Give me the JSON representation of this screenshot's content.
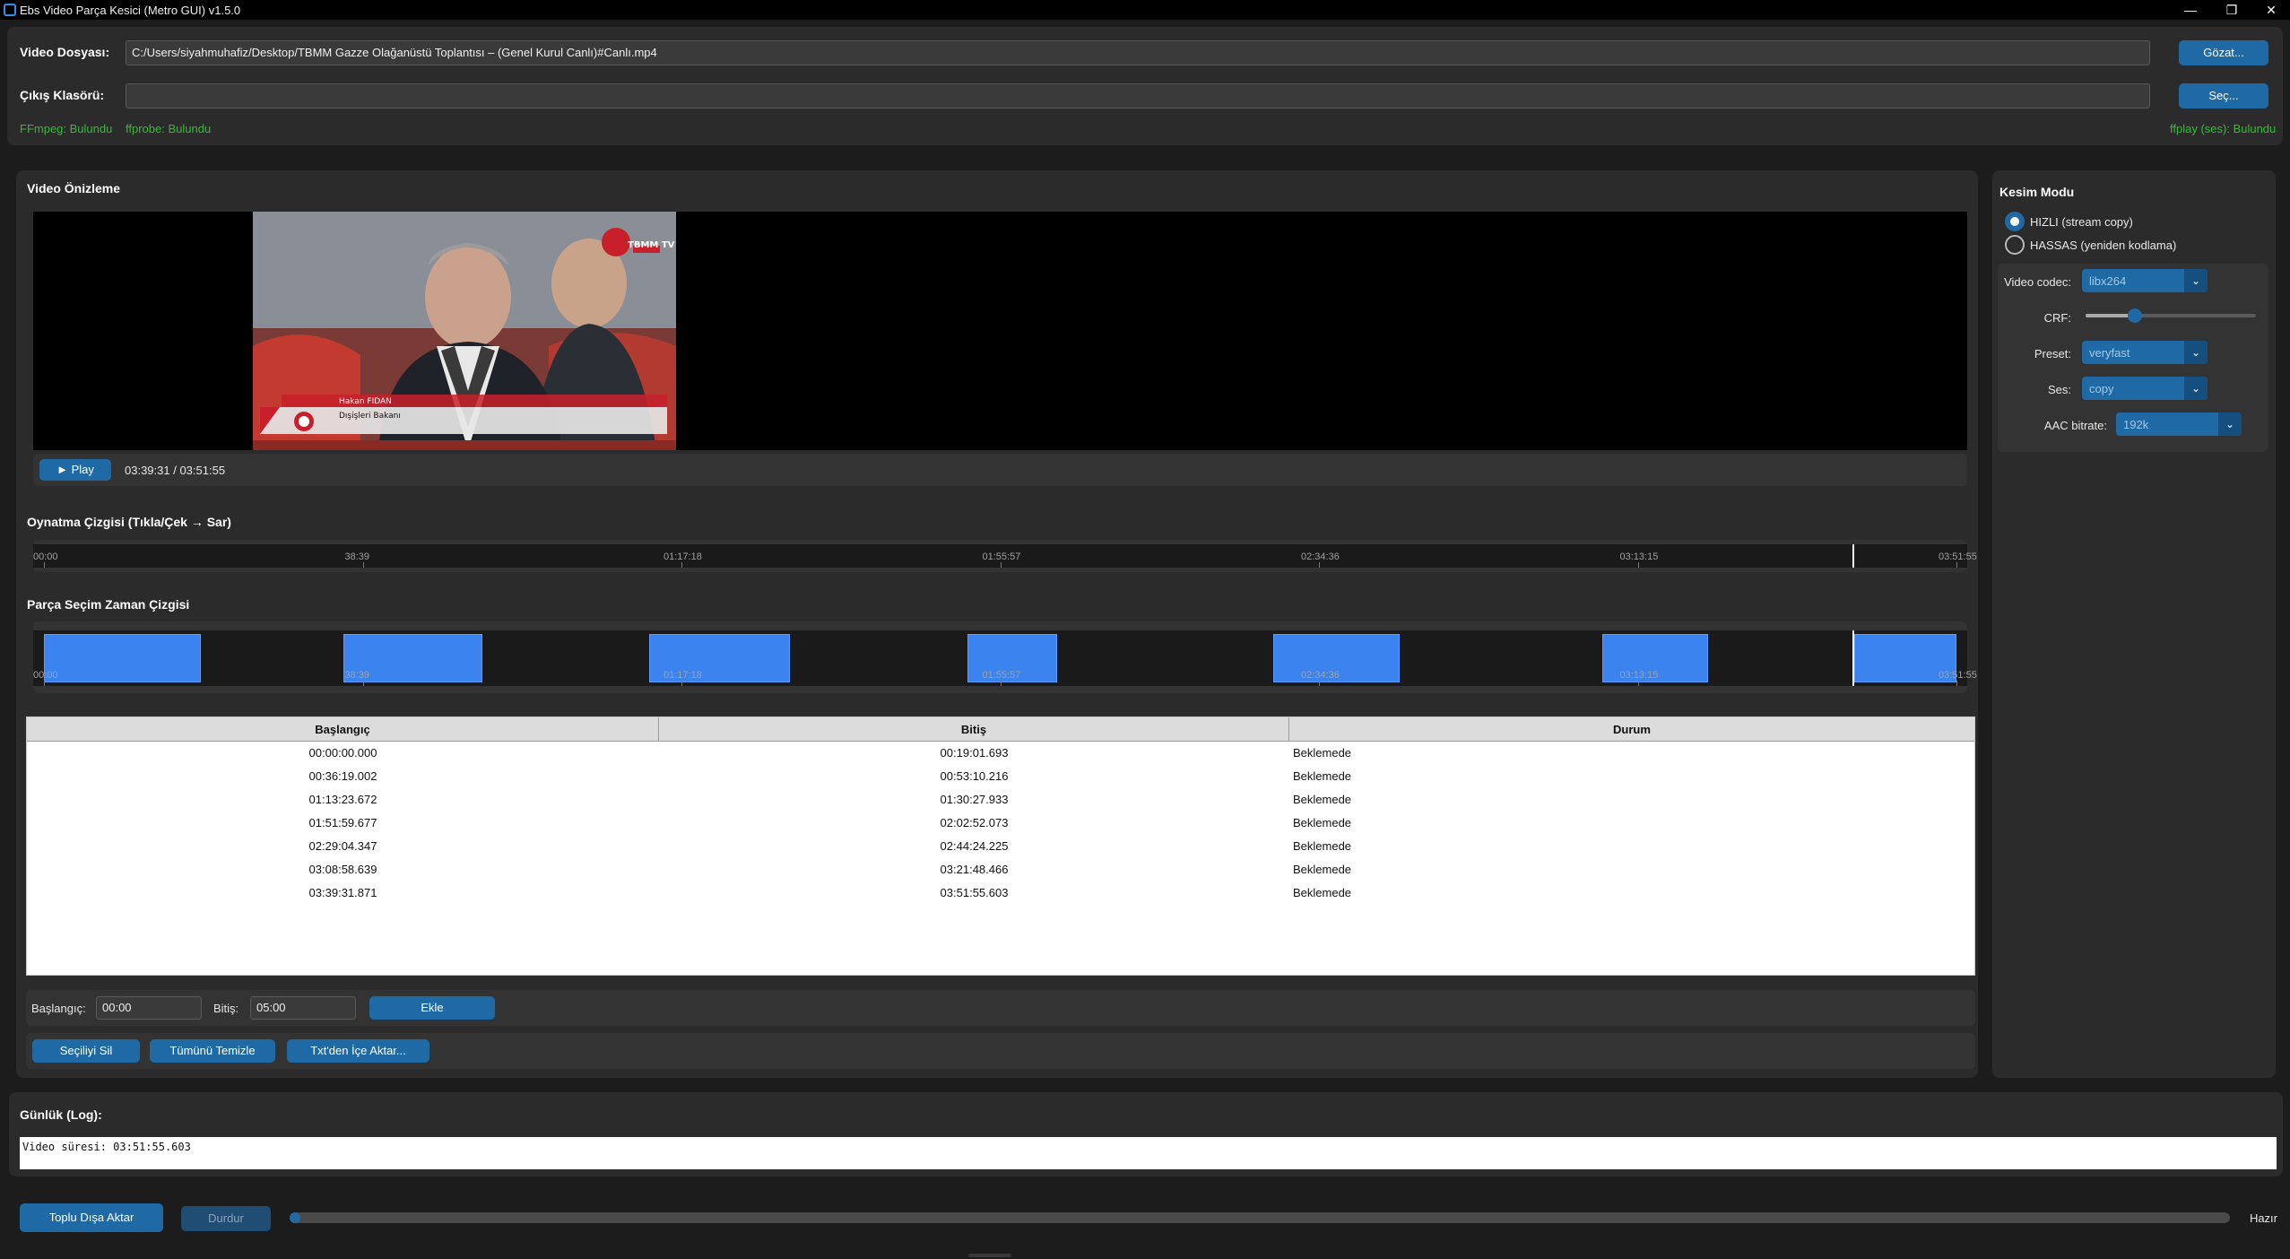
{
  "window": {
    "title": "Ebs Video Parça Kesici (Metro GUI)  v1.5.0",
    "minimize": "—",
    "restore": "❐",
    "close": "✕"
  },
  "files": {
    "video_label": "Video Dosyası:",
    "video_path": "C:/Users/siyahmuhafiz/Desktop/TBMM Gazze Olağanüstü Toplantısı –  (Genel Kurul Canlı)#Canlı.mp4",
    "browse_label": "Gözat...",
    "output_label": "Çıkış Klasörü:",
    "output_path": "",
    "select_label": "Seç...",
    "ffmpeg_status": "FFmpeg: Bulundu",
    "ffprobe_status": "ffprobe: Bulundu",
    "ffplay_status": "ffplay (ses): Bulundu"
  },
  "preview": {
    "title": "Video Önizleme",
    "play_label": "► Play",
    "time_display": "03:39:31 / 03:51:55",
    "lower_third_name": "Hakan FIDAN",
    "lower_third_title": "Dışişleri Bakanı",
    "channel_logo": "TBMM TV CANLI"
  },
  "playback_timeline": {
    "title": "Oynatma Çizgisi (Tıkla/Çek → Sar)",
    "ticks": [
      "00:00",
      "38:39",
      "01:17:18",
      "01:55:57",
      "02:34:36",
      "03:13:15",
      "03:51:55"
    ],
    "cursor_fraction": 0.9455
  },
  "segment_timeline": {
    "title": "Parça Seçim Zaman Çizgisi",
    "ticks": [
      "00:00",
      "38:39",
      "01:17:18",
      "01:55:57",
      "02:34:36",
      "03:13:15",
      "03:51:55"
    ],
    "cursor_fraction": 0.9455
  },
  "table": {
    "columns": [
      "Başlangıç",
      "Bitiş",
      "Durum"
    ],
    "rows": [
      [
        "00:00:00.000",
        "00:19:01.693",
        "Beklemede"
      ],
      [
        "00:36:19.002",
        "00:53:10.216",
        "Beklemede"
      ],
      [
        "01:13:23.672",
        "01:30:27.933",
        "Beklemede"
      ],
      [
        "01:51:59.677",
        "02:02:52.073",
        "Beklemede"
      ],
      [
        "02:29:04.347",
        "02:44:24.225",
        "Beklemede"
      ],
      [
        "03:08:58.639",
        "03:21:48.466",
        "Beklemede"
      ],
      [
        "03:39:31.871",
        "03:51:55.603",
        "Beklemede"
      ]
    ]
  },
  "segment_entry": {
    "start_label": "Başlangıç:",
    "start_value": "00:00",
    "end_label": "Bitiş:",
    "end_value": "05:00",
    "add_label": "Ekle"
  },
  "actions": {
    "delete_selected": "Seçiliyi Sil",
    "clear_all": "Tümünü Temizle",
    "import_txt": "Txt'den İçe Aktar..."
  },
  "cut_mode": {
    "title": "Kesim Modu",
    "fast_label": "HIZLI (stream copy)",
    "precise_label": "HASSAS (yeniden kodlama)",
    "selected": "fast",
    "video_codec_label": "Video codec:",
    "video_codec_value": "libx264",
    "crf_label": "CRF:",
    "crf_fraction": 0.29,
    "preset_label": "Preset:",
    "preset_value": "veryfast",
    "audio_label": "Ses:",
    "audio_value": "copy",
    "aac_label": "AAC bitrate:",
    "aac_value": "192k"
  },
  "log": {
    "title": "Günlük (Log):",
    "text": "Video süresi: 03:51:55.603"
  },
  "bottom": {
    "export_label": "Toplu Dışa Aktar",
    "stop_label": "Durdur",
    "status": "Hazır",
    "progress_fraction": 0.005
  },
  "colors": {
    "accent": "#1f6aa5",
    "segment": "#3b84f0",
    "status_green": "#2fbf2f"
  }
}
